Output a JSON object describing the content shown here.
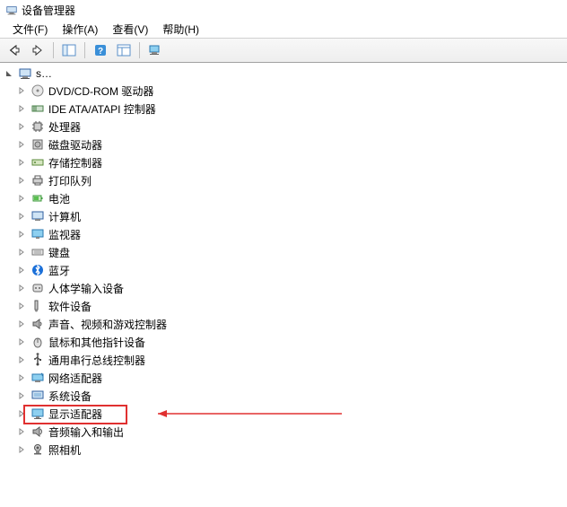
{
  "window": {
    "title": "设备管理器"
  },
  "menu": {
    "file": "文件(F)",
    "action": "操作(A)",
    "view": "查看(V)",
    "help": "帮助(H)"
  },
  "toolbar": {
    "back": "back",
    "forward": "forward",
    "show_hide": "show-hide-console-tree",
    "help": "help",
    "properties": "properties",
    "monitor": "scan-hardware"
  },
  "tree": {
    "root": {
      "label": "s…",
      "expanded": true
    },
    "items": [
      {
        "label": "DVD/CD-ROM 驱动器",
        "icon": "disc"
      },
      {
        "label": "IDE ATA/ATAPI 控制器",
        "icon": "ide"
      },
      {
        "label": "处理器",
        "icon": "cpu"
      },
      {
        "label": "磁盘驱动器",
        "icon": "disk"
      },
      {
        "label": "存储控制器",
        "icon": "storage"
      },
      {
        "label": "打印队列",
        "icon": "printer"
      },
      {
        "label": "电池",
        "icon": "battery"
      },
      {
        "label": "计算机",
        "icon": "computer"
      },
      {
        "label": "监视器",
        "icon": "monitor"
      },
      {
        "label": "键盘",
        "icon": "keyboard"
      },
      {
        "label": "蓝牙",
        "icon": "bluetooth"
      },
      {
        "label": "人体学输入设备",
        "icon": "hid"
      },
      {
        "label": "软件设备",
        "icon": "software"
      },
      {
        "label": "声音、视频和游戏控制器",
        "icon": "sound"
      },
      {
        "label": "鼠标和其他指针设备",
        "icon": "mouse"
      },
      {
        "label": "通用串行总线控制器",
        "icon": "usb"
      },
      {
        "label": "网络适配器",
        "icon": "network"
      },
      {
        "label": "系统设备",
        "icon": "system"
      },
      {
        "label": "显示适配器",
        "icon": "display",
        "highlighted": true
      },
      {
        "label": "音频输入和输出",
        "icon": "audioio"
      },
      {
        "label": "照相机",
        "icon": "camera"
      }
    ]
  },
  "annotation": {
    "highlight_color": "#e03030",
    "arrow_color": "#e03030"
  }
}
